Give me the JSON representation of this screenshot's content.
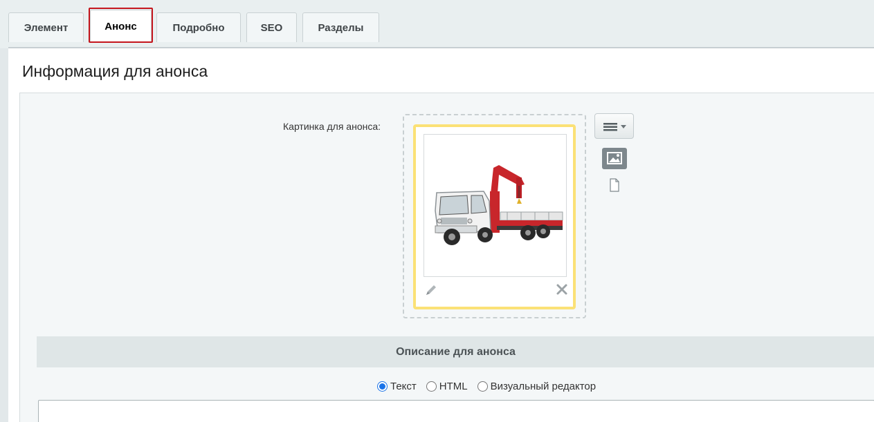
{
  "tabs": [
    {
      "label": "Элемент",
      "active": false
    },
    {
      "label": "Анонс",
      "active": true
    },
    {
      "label": "Подробно",
      "active": false
    },
    {
      "label": "SEO",
      "active": false
    },
    {
      "label": "Разделы",
      "active": false
    }
  ],
  "panel": {
    "title": "Информация для анонса",
    "preview_image": {
      "label": "Картинка для анонса:",
      "image": "crane-truck-photo",
      "edit_icon": "pencil-icon",
      "remove_icon": "close-icon"
    },
    "toolbar": {
      "menu_icon": "hamburger-menu-icon",
      "image_type_icon": "image-icon",
      "file_type_icon": "file-icon"
    },
    "description": {
      "header": "Описание для анонса",
      "modes": [
        {
          "label": "Текст",
          "checked": true
        },
        {
          "label": "HTML",
          "checked": false
        },
        {
          "label": "Визуальный редактор",
          "checked": false
        }
      ],
      "value": ""
    }
  },
  "colors": {
    "tab_highlight": "#c4151c",
    "image_border": "#fbe176",
    "radio_checked": "#1a73e8"
  }
}
